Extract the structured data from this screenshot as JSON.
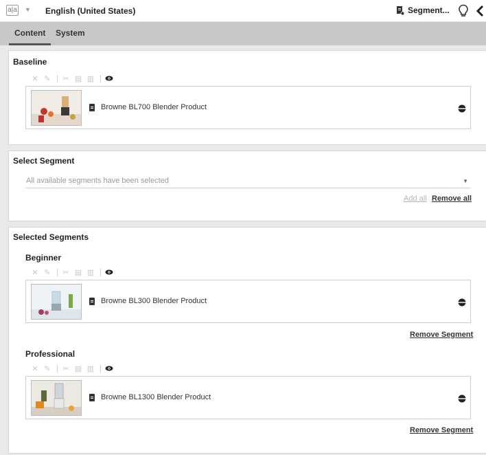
{
  "header": {
    "language_label": "English (United States)",
    "segment_button": "Segment..."
  },
  "tabs": [
    {
      "label": "Content",
      "active": true
    },
    {
      "label": "System",
      "active": false
    }
  ],
  "baseline": {
    "title": "Baseline",
    "item_label": "Browne BL700 Blender Product"
  },
  "select_segment": {
    "title": "Select Segment",
    "dropdown_value": "All available segments have been selected",
    "add_all": "Add all",
    "remove_all": "Remove all"
  },
  "selected_segments": {
    "title": "Selected Segments",
    "segments": [
      {
        "name": "Beginner",
        "item_label": "Browne BL300 Blender Product",
        "remove_label": "Remove Segment"
      },
      {
        "name": "Professional",
        "item_label": "Browne BL1300 Blender Product",
        "remove_label": "Remove Segment"
      }
    ]
  },
  "colors": {
    "tab_bar": "#c8c8c8",
    "background": "#e9e9e9",
    "panel": "#ffffff",
    "disabled_icon": "#c8c8c8"
  },
  "icons": {
    "toolbar": [
      "close-icon",
      "edit-icon",
      "cut-icon",
      "copy-icon",
      "paste-icon",
      "eye-icon"
    ],
    "item_doc": "document-icon",
    "item_locale": "globe-icon"
  }
}
